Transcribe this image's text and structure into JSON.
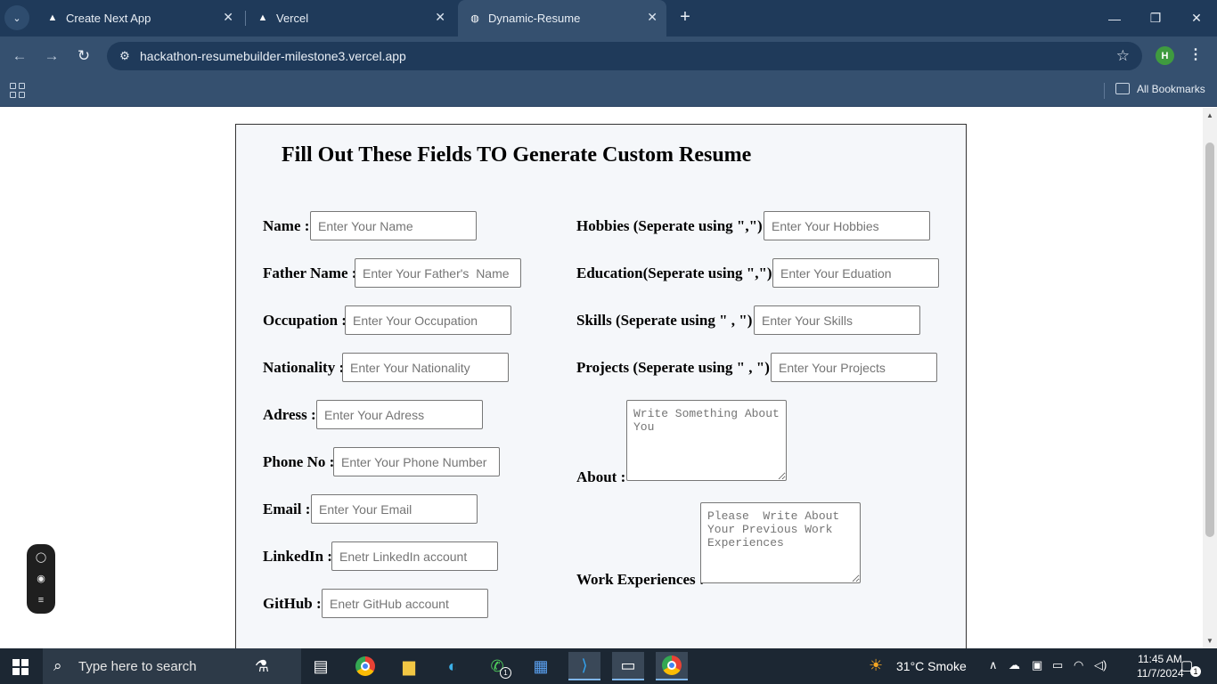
{
  "browser": {
    "tabs": [
      {
        "title": "Create Next App",
        "icon": "vercel-triangle-icon",
        "close": "✕"
      },
      {
        "title": "Vercel",
        "icon": "vercel-triangle-icon",
        "close": "✕"
      },
      {
        "title": "Dynamic-Resume",
        "icon": "globe-icon",
        "close": "✕"
      }
    ],
    "new_tab": "+",
    "url": "hackathon-resumebuilder-milestone3.vercel.app",
    "profile_initial": "H",
    "bookmarks_label": "All Bookmarks",
    "accent_color": "#35506f"
  },
  "form": {
    "title": "Fill Out These Fields TO Generate Custom Resume",
    "left_fields": [
      {
        "label": "Name :",
        "placeholder": "Enter Your Name"
      },
      {
        "label": "Father Name :",
        "placeholder": "Enter Your Father's  Name"
      },
      {
        "label": "Occupation :",
        "placeholder": "Enter Your Occupation"
      },
      {
        "label": "Nationality :",
        "placeholder": "Enter Your Nationality"
      },
      {
        "label": "Adress :",
        "placeholder": "Enter Your Adress"
      },
      {
        "label": "Phone No :",
        "placeholder": "Enter Your Phone Number"
      },
      {
        "label": "Email :",
        "placeholder": "Enter Your Email"
      },
      {
        "label": "LinkedIn :",
        "placeholder": "Enetr LinkedIn account"
      },
      {
        "label": "GitHub :",
        "placeholder": "Enetr GitHub account"
      }
    ],
    "right_fields": [
      {
        "label": "Hobbies (Seperate using \",\") :",
        "placeholder": "Enter Your Hobbies"
      },
      {
        "label": "Education(Seperate using \",\") :",
        "placeholder": "Enter Your Eduation"
      },
      {
        "label": "Skills (Seperate using \" , \") :",
        "placeholder": "Enter Your Skills"
      },
      {
        "label": "Projects (Seperate using \" , \") :",
        "placeholder": "Enter Your Projects"
      }
    ],
    "about": {
      "label": "About :",
      "placeholder": "Write Something About You"
    },
    "work": {
      "label": "Work Experiences :",
      "placeholder": "Please  Write About Your Previous Work Experiences"
    }
  },
  "taskbar": {
    "search_placeholder": "Type here to search",
    "weather": "31°C  Smoke",
    "time": "11:45 AM",
    "date": "11/7/2024",
    "whatsapp_badge": "1",
    "notification_count": "1"
  }
}
